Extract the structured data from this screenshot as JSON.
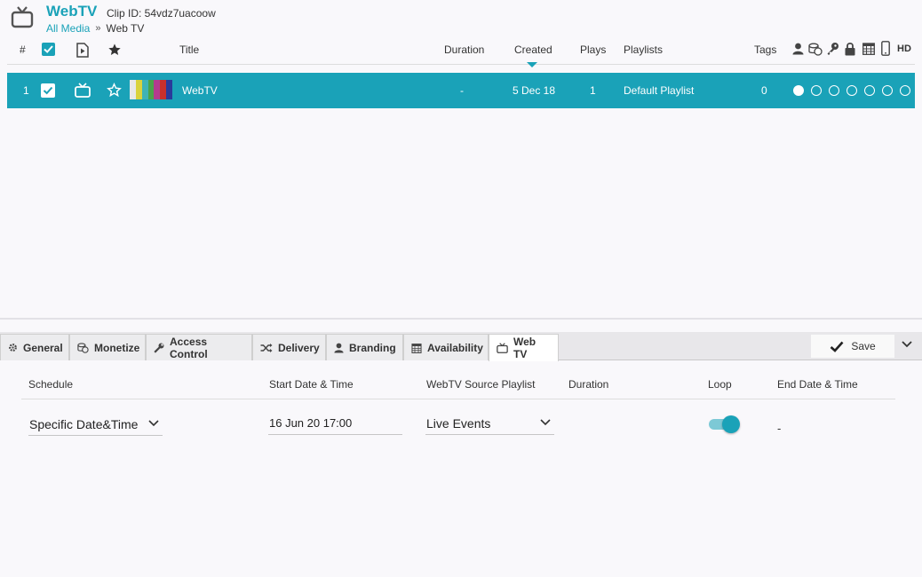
{
  "header": {
    "app_title": "WebTV",
    "clip_id": "Clip ID: 54vdz7uacoow",
    "breadcrumb": {
      "link": "All Media",
      "separator": "»",
      "current": "Web TV"
    }
  },
  "columns": {
    "number": "#",
    "title": "Title",
    "duration": "Duration",
    "created": "Created",
    "plays": "Plays",
    "playlists": "Playlists",
    "tags": "Tags",
    "hd": "HD"
  },
  "row": {
    "number": "1",
    "title": "WebTV",
    "duration": "-",
    "created": "5 Dec 18",
    "plays": "1",
    "playlist": "Default Playlist",
    "tags": "0",
    "status_dots": [
      true,
      false,
      false,
      false,
      false,
      false,
      false
    ]
  },
  "tabs": [
    {
      "label": "General",
      "icon": "gear-icon"
    },
    {
      "label": "Monetize",
      "icon": "coins-icon"
    },
    {
      "label": "Access Control",
      "icon": "key-icon"
    },
    {
      "label": "Delivery",
      "icon": "shuffle-icon"
    },
    {
      "label": "Branding",
      "icon": "user-icon"
    },
    {
      "label": "Availability",
      "icon": "calendar-icon"
    },
    {
      "label": "Web TV",
      "icon": "tv-icon",
      "active": true
    }
  ],
  "save_label": "Save",
  "webtv_form": {
    "headers": {
      "schedule": "Schedule",
      "start": "Start Date & Time",
      "source": "WebTV Source Playlist",
      "duration": "Duration",
      "loop": "Loop",
      "end": "End Date & Time"
    },
    "schedule_value": "Specific Date&Time",
    "start_value": "16 Jun 20 17:00",
    "source_value": "Live Events",
    "loop_on": true,
    "end_value": "-"
  },
  "colors": {
    "accent": "#1aa2b8"
  }
}
